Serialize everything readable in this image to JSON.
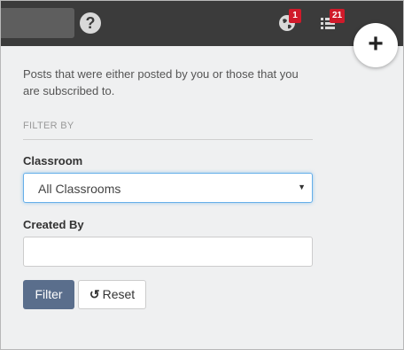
{
  "header": {
    "help_icon": "question-circle-icon",
    "help_glyph": "?",
    "notifications": [
      {
        "icon": "globe-icon",
        "count": "1"
      },
      {
        "icon": "list-icon",
        "count": "21"
      }
    ],
    "add_icon": "plus-icon",
    "add_glyph": "+"
  },
  "main": {
    "description": "Posts that were either posted by you or those that you are subscribed to.",
    "filter_by_label": "FILTER BY",
    "classroom_label": "Classroom",
    "classroom_value": "All Classrooms",
    "created_by_label": "Created By",
    "created_by_value": "",
    "filter_button": "Filter",
    "reset_button": "Reset",
    "reset_icon": "undo-icon"
  },
  "colors": {
    "topbar": "#3b3b3b",
    "badge": "#d01a2a",
    "filter_button": "#5a6e8c",
    "focus_border": "#66afe9"
  }
}
